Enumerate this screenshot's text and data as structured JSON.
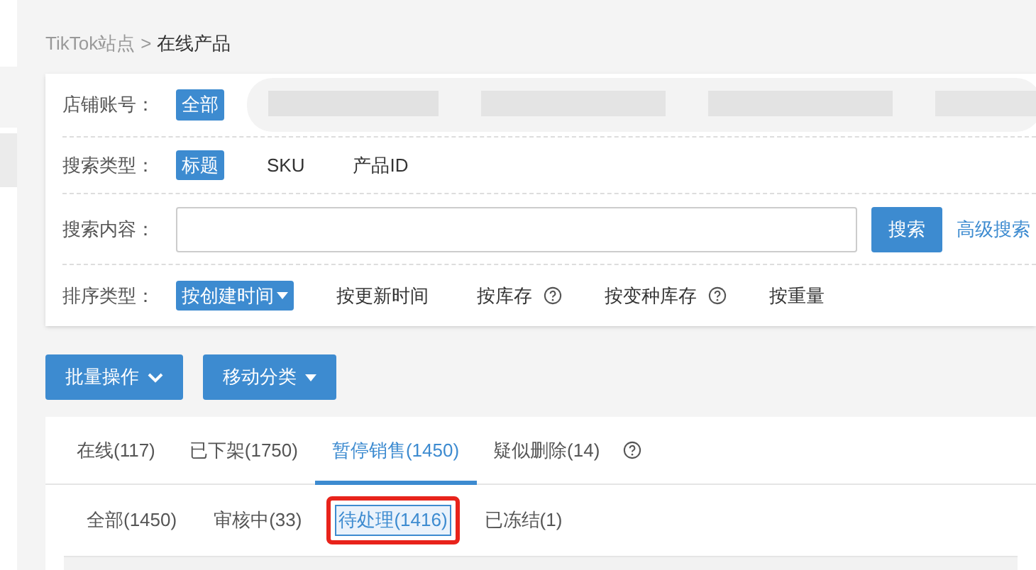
{
  "breadcrumb": [
    {
      "label": "TikTok站点",
      "current": false
    },
    {
      "label": "在线产品",
      "current": true
    }
  ],
  "breadcrumb_separator": ">",
  "filters": [
    {
      "kind": "chips",
      "label": "店铺账号：",
      "options": [
        {
          "label": "全部",
          "selected": true,
          "kind": "plain"
        }
      ],
      "redacted": true
    },
    {
      "kind": "chips",
      "label": "搜索类型：",
      "options": [
        {
          "label": "标题",
          "selected": true,
          "kind": "plain"
        },
        {
          "label": "SKU",
          "selected": false,
          "kind": "plain"
        },
        {
          "label": "产品ID",
          "selected": false,
          "kind": "plain"
        }
      ]
    },
    {
      "kind": "search",
      "label": "搜索内容：",
      "button": "搜索",
      "link": "高级搜索"
    },
    {
      "kind": "chips",
      "label": "排序类型：",
      "options": [
        {
          "label": "按创建时间",
          "selected": true,
          "kind": "dropdown"
        },
        {
          "label": "按更新时间",
          "selected": false,
          "kind": "plain"
        },
        {
          "label": "按库存",
          "selected": false,
          "kind": "help"
        },
        {
          "label": "按变种库存",
          "selected": false,
          "kind": "help"
        },
        {
          "label": "按重量",
          "selected": false,
          "kind": "plain"
        }
      ]
    }
  ],
  "actions": [
    {
      "label": "批量操作",
      "kind": "chevron"
    },
    {
      "label": "移动分类",
      "kind": "triangle"
    }
  ],
  "tabs": [
    {
      "label": "在线(117)",
      "selected": false,
      "kind": "plain"
    },
    {
      "label": "已下架(1750)",
      "selected": false,
      "kind": "plain"
    },
    {
      "label": "暂停销售(1450)",
      "selected": true,
      "kind": "plain"
    },
    {
      "label": "疑似删除(14)",
      "selected": false,
      "kind": "help"
    }
  ],
  "subtabs": [
    {
      "label": "全部(1450)",
      "selected": false,
      "highlighted": false
    },
    {
      "label": "审核中(33)",
      "selected": false,
      "highlighted": false
    },
    {
      "label": "待处理(1416)",
      "selected": true,
      "highlighted": true
    },
    {
      "label": "已冻结(1)",
      "selected": false,
      "highlighted": false
    }
  ]
}
